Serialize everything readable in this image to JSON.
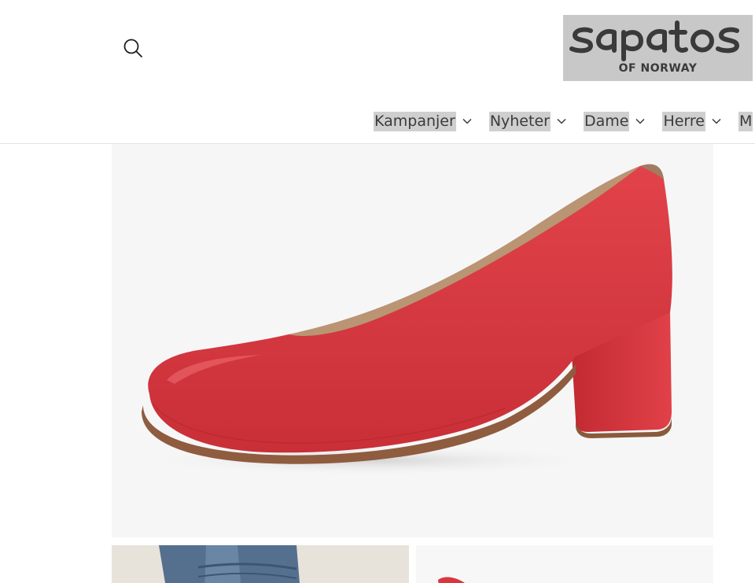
{
  "header": {
    "search": {
      "icon": "search-icon"
    },
    "logo": {
      "wordmark": "sapatos",
      "subtitle": "OF NORWAY"
    }
  },
  "nav": {
    "items": [
      {
        "label": "Kampanjer",
        "icon": "chevron-down-icon"
      },
      {
        "label": "Nyheter",
        "icon": "chevron-down-icon"
      },
      {
        "label": "Dame",
        "icon": "chevron-down-icon"
      },
      {
        "label": "Herre",
        "icon": "chevron-down-icon"
      },
      {
        "label": "M",
        "icon": ""
      }
    ]
  },
  "product": {
    "main_image": {
      "subject": "red-pump-shoe",
      "color": "#d9363e"
    },
    "thumbnails": [
      {
        "subject": "jeans-with-shoe"
      },
      {
        "subject": "red-shoe-detail"
      }
    ]
  },
  "colors": {
    "shoe_red": "#d9363e",
    "logo_bg": "#c8c8c8",
    "nav_highlight": "#cfcfcf"
  }
}
